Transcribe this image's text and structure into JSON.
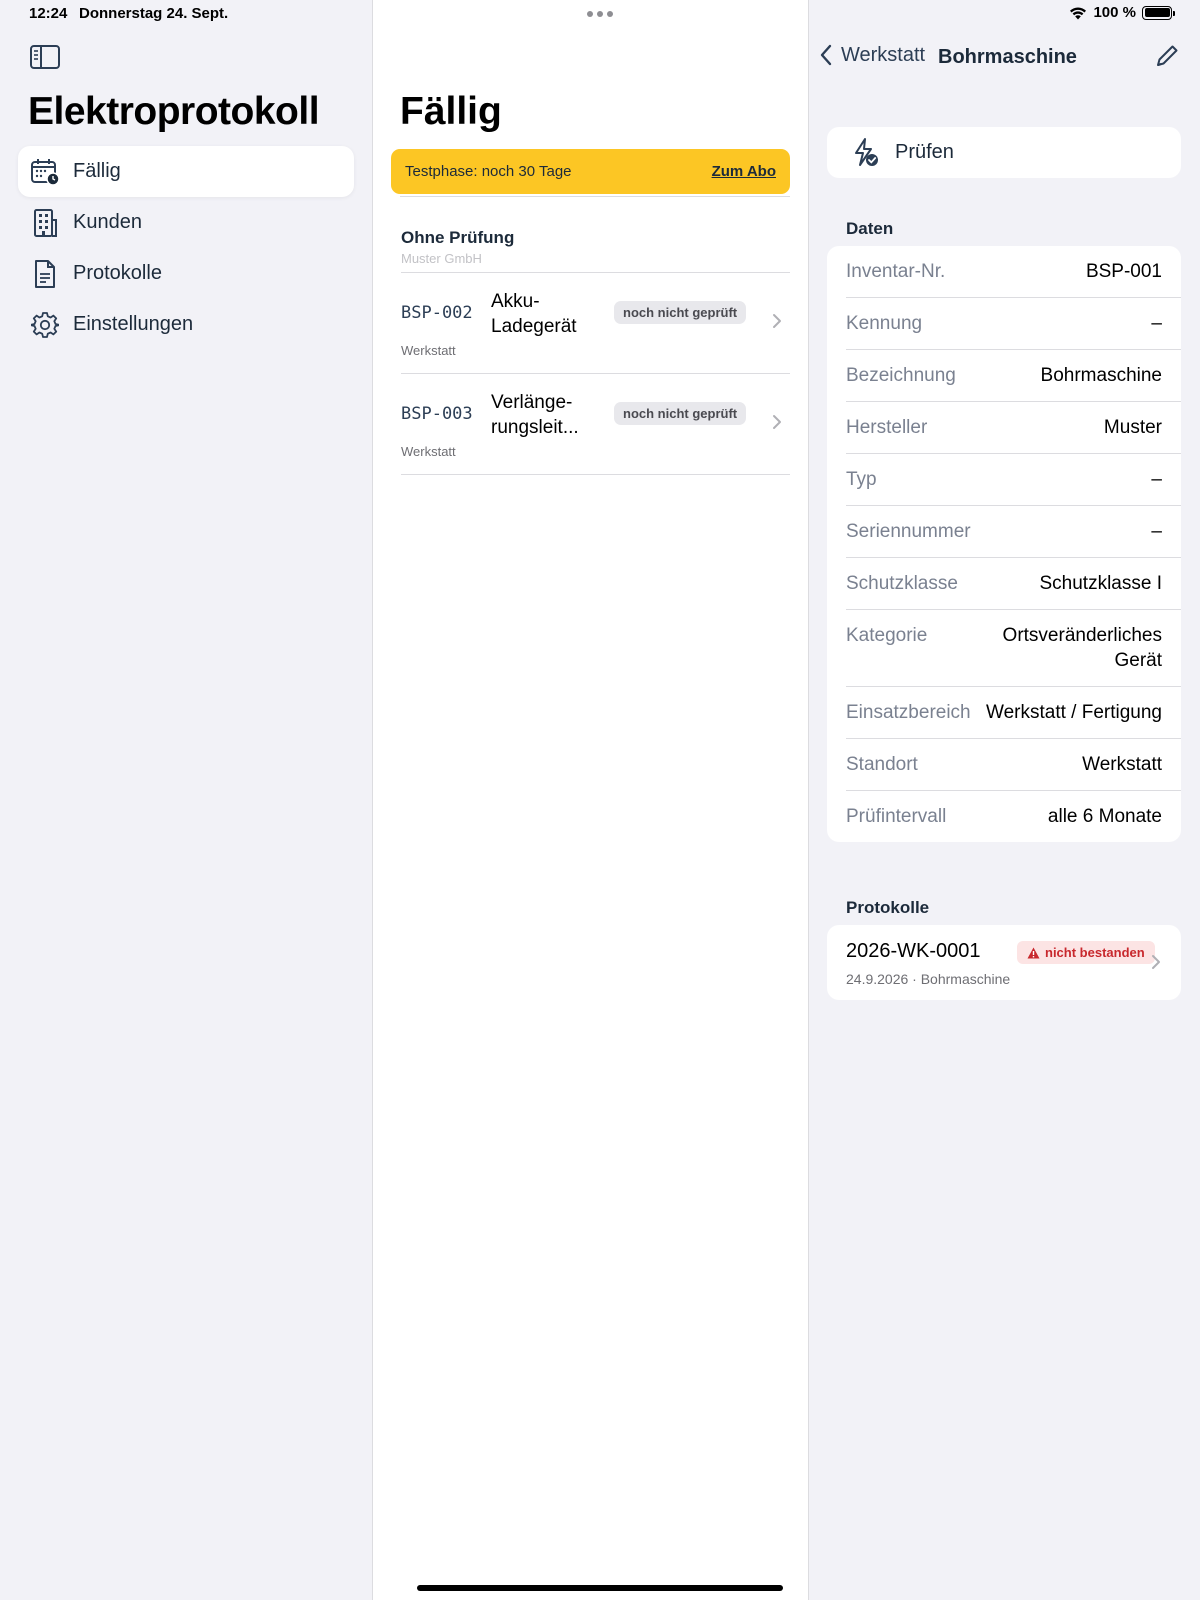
{
  "status": {
    "time": "12:24",
    "date": "Donnerstag 24. Sept.",
    "battery": "100 %"
  },
  "sidebar": {
    "title": "Elektroprotokoll",
    "items": [
      {
        "label": "Fällig",
        "icon": "calendar-clock-icon",
        "active": true
      },
      {
        "label": "Kunden",
        "icon": "building-icon"
      },
      {
        "label": "Protokolle",
        "icon": "document-icon"
      },
      {
        "label": "Einstellungen",
        "icon": "gear-icon"
      }
    ]
  },
  "list": {
    "title": "Fällig",
    "trial": {
      "text": "Testphase: noch 30 Tage",
      "link": "Zum Abo"
    },
    "section": {
      "title": "Ohne Prüfung",
      "subtitle": "Muster GmbH"
    },
    "devices": [
      {
        "id": "BSP-002",
        "name": "Akku-Ladegerät",
        "location": "Werkstatt",
        "badge": "noch nicht geprüft"
      },
      {
        "id": "BSP-003",
        "name": "Verlänge-rungsleit...",
        "location": "Werkstatt",
        "badge": "noch nicht geprüft"
      }
    ]
  },
  "detail": {
    "back_label": "Werkstatt",
    "title": "Bohrmaschine",
    "action_label": "Prüfen",
    "data_header": "Daten",
    "fields": [
      {
        "key": "Inventar-Nr.",
        "value": "BSP-001"
      },
      {
        "key": "Kennung",
        "value": "–"
      },
      {
        "key": "Bezeichnung",
        "value": "Bohrmaschine"
      },
      {
        "key": "Hersteller",
        "value": "Muster"
      },
      {
        "key": "Typ",
        "value": "–"
      },
      {
        "key": "Seriennummer",
        "value": "–"
      },
      {
        "key": "Schutzklasse",
        "value": "Schutzklasse I"
      },
      {
        "key": "Kategorie",
        "value": "Ortsveränderliches Gerät"
      },
      {
        "key": "Einsatzbereich",
        "value": "Werkstatt / Fertigung"
      },
      {
        "key": "Standort",
        "value": "Werkstatt"
      },
      {
        "key": "Prüfintervall",
        "value": "alle 6 Monate"
      }
    ],
    "protocols_header": "Protokolle",
    "protocol": {
      "id": "2026-WK-0001",
      "status": "nicht bestanden",
      "subtitle": "24.9.2026 · Bohrmaschine"
    }
  },
  "colors": {
    "accent": "#1c2a3a",
    "banner": "#fcc624",
    "fail_bg": "#fce4e4",
    "fail_text": "#c8282d"
  }
}
